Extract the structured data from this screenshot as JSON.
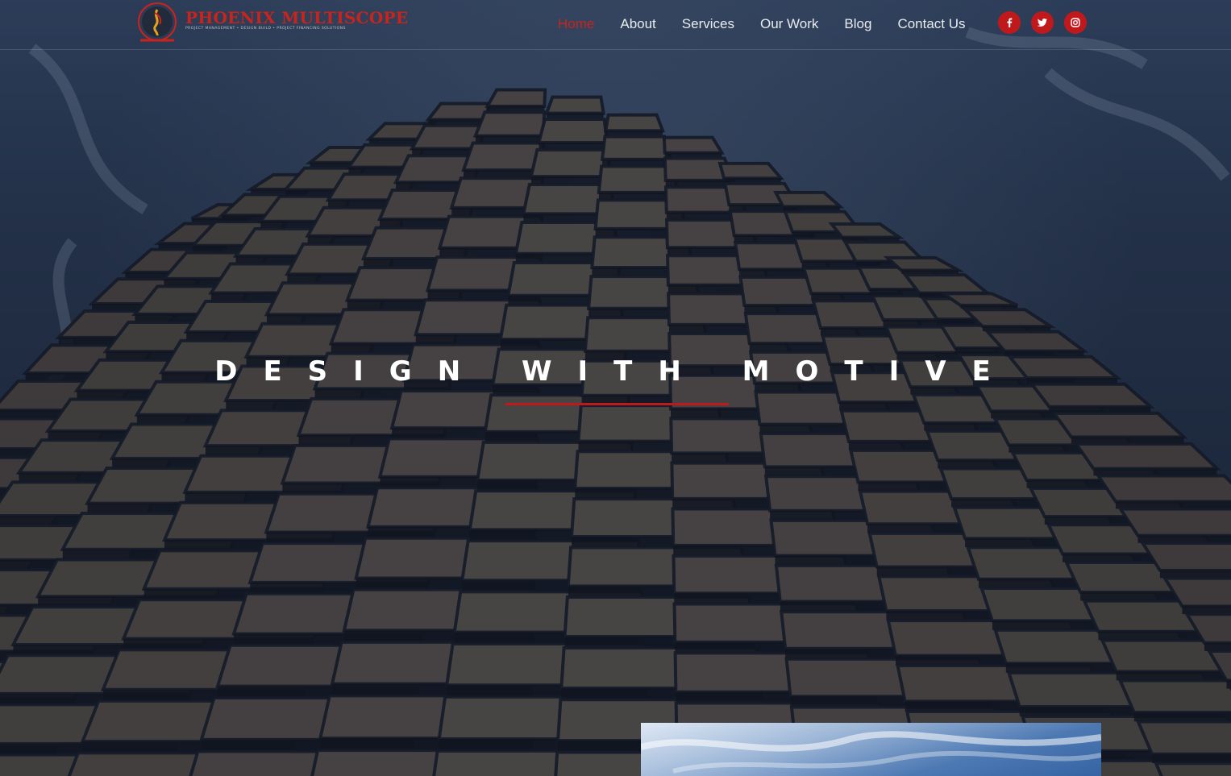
{
  "brand": {
    "name": "PHOENIX MULTISCOPE",
    "tagline": "PROJECT MANAGEMENT • DESIGN BUILD • PROJECT FINANCING SOLUTIONS"
  },
  "nav": {
    "items": [
      {
        "label": "Home",
        "active": true
      },
      {
        "label": "About",
        "active": false
      },
      {
        "label": "Services",
        "active": false
      },
      {
        "label": "Our Work",
        "active": false
      },
      {
        "label": "Blog",
        "active": false
      },
      {
        "label": "Contact Us",
        "active": false
      }
    ]
  },
  "social": [
    {
      "icon": "facebook-icon"
    },
    {
      "icon": "twitter-icon"
    },
    {
      "icon": "instagram-icon"
    }
  ],
  "hero": {
    "headline": "DESIGN WITH MOTIVE"
  },
  "colors": {
    "accent": "#c0191c",
    "nav_text": "#e9ecef",
    "active_nav": "#c8241c",
    "headline": "#ffffff"
  }
}
